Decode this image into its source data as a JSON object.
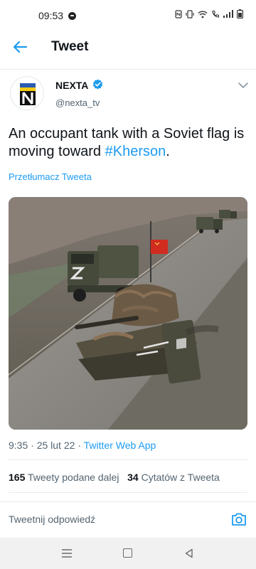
{
  "status_bar": {
    "time": "09:53",
    "icons": [
      "message-icon",
      "nfc-icon",
      "vibrate-icon",
      "wifi-icon",
      "call-icon",
      "signal-icon",
      "battery-icon"
    ]
  },
  "header": {
    "title": "Tweet"
  },
  "author": {
    "name": "NEXTA",
    "handle": "@nexta_tv",
    "avatar_letter": "N",
    "verified": true
  },
  "tweet": {
    "text": "An occupant tank with a Soviet flag is moving toward ",
    "hashtag": "#Kherson",
    "text_end": ".",
    "translate_link": "Przetłumacz Tweeta"
  },
  "meta": {
    "time": "9:35",
    "separator": " · ",
    "date": "25 lut 22",
    "source": "Twitter Web App"
  },
  "stats": {
    "retweets_count": "165",
    "retweets_label": "Tweety podane dalej",
    "quotes_count": "34",
    "quotes_label": "Cytatów z Tweeta"
  },
  "reply": {
    "placeholder": "Tweetnij odpowiedź"
  },
  "colors": {
    "accent": "#1d9bf0",
    "text": "#0f1419",
    "secondary": "#536471",
    "divider": "#e6ecf0",
    "flag": "#d22b1f"
  },
  "nav_bar": {
    "icons": [
      "menu-icon",
      "home-icon",
      "back-icon"
    ]
  }
}
